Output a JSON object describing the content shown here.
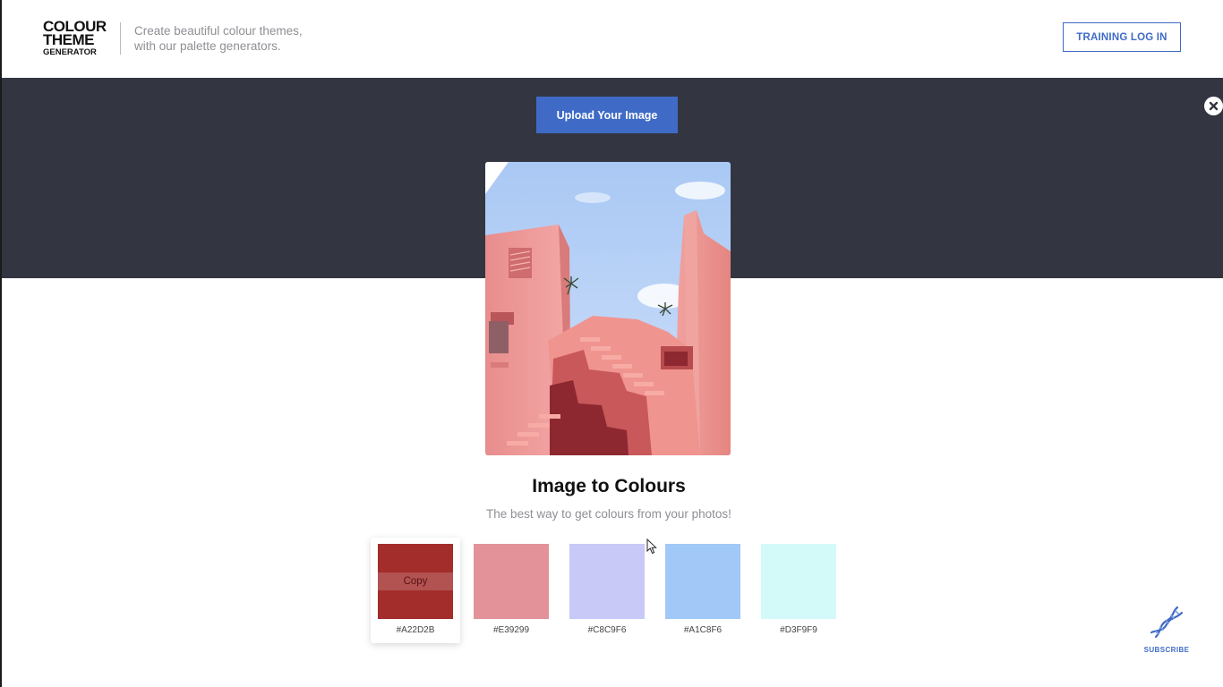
{
  "header": {
    "logo": {
      "line1": "COLOUR",
      "line2": "THEME",
      "line3": "GENERATOR"
    },
    "tagline": {
      "line1": "Create beautiful colour themes,",
      "line2": "with our palette generators."
    },
    "login_label": "TRAINING LOG IN"
  },
  "hero": {
    "upload_label": "Upload Your Image",
    "close_icon": "close-icon"
  },
  "main": {
    "title": "Image to Colours",
    "subtitle": "The best way to get colours from your photos!"
  },
  "palette": {
    "copy_label": "Copy",
    "swatches": [
      {
        "hex": "#A22D2B",
        "color": "#A22D2B"
      },
      {
        "hex": "#E39299",
        "color": "#E39299"
      },
      {
        "hex": "#C8C9F6",
        "color": "#C8C9F6"
      },
      {
        "hex": "#A1C8F6",
        "color": "#A1C8F6"
      },
      {
        "hex": "#D3F9F9",
        "color": "#D3F9F9"
      }
    ]
  },
  "subscribe": {
    "label": "SUBSCRIBE",
    "icon": "dna-icon"
  },
  "colors": {
    "accent": "#3F6BC6",
    "band": "#333641"
  }
}
